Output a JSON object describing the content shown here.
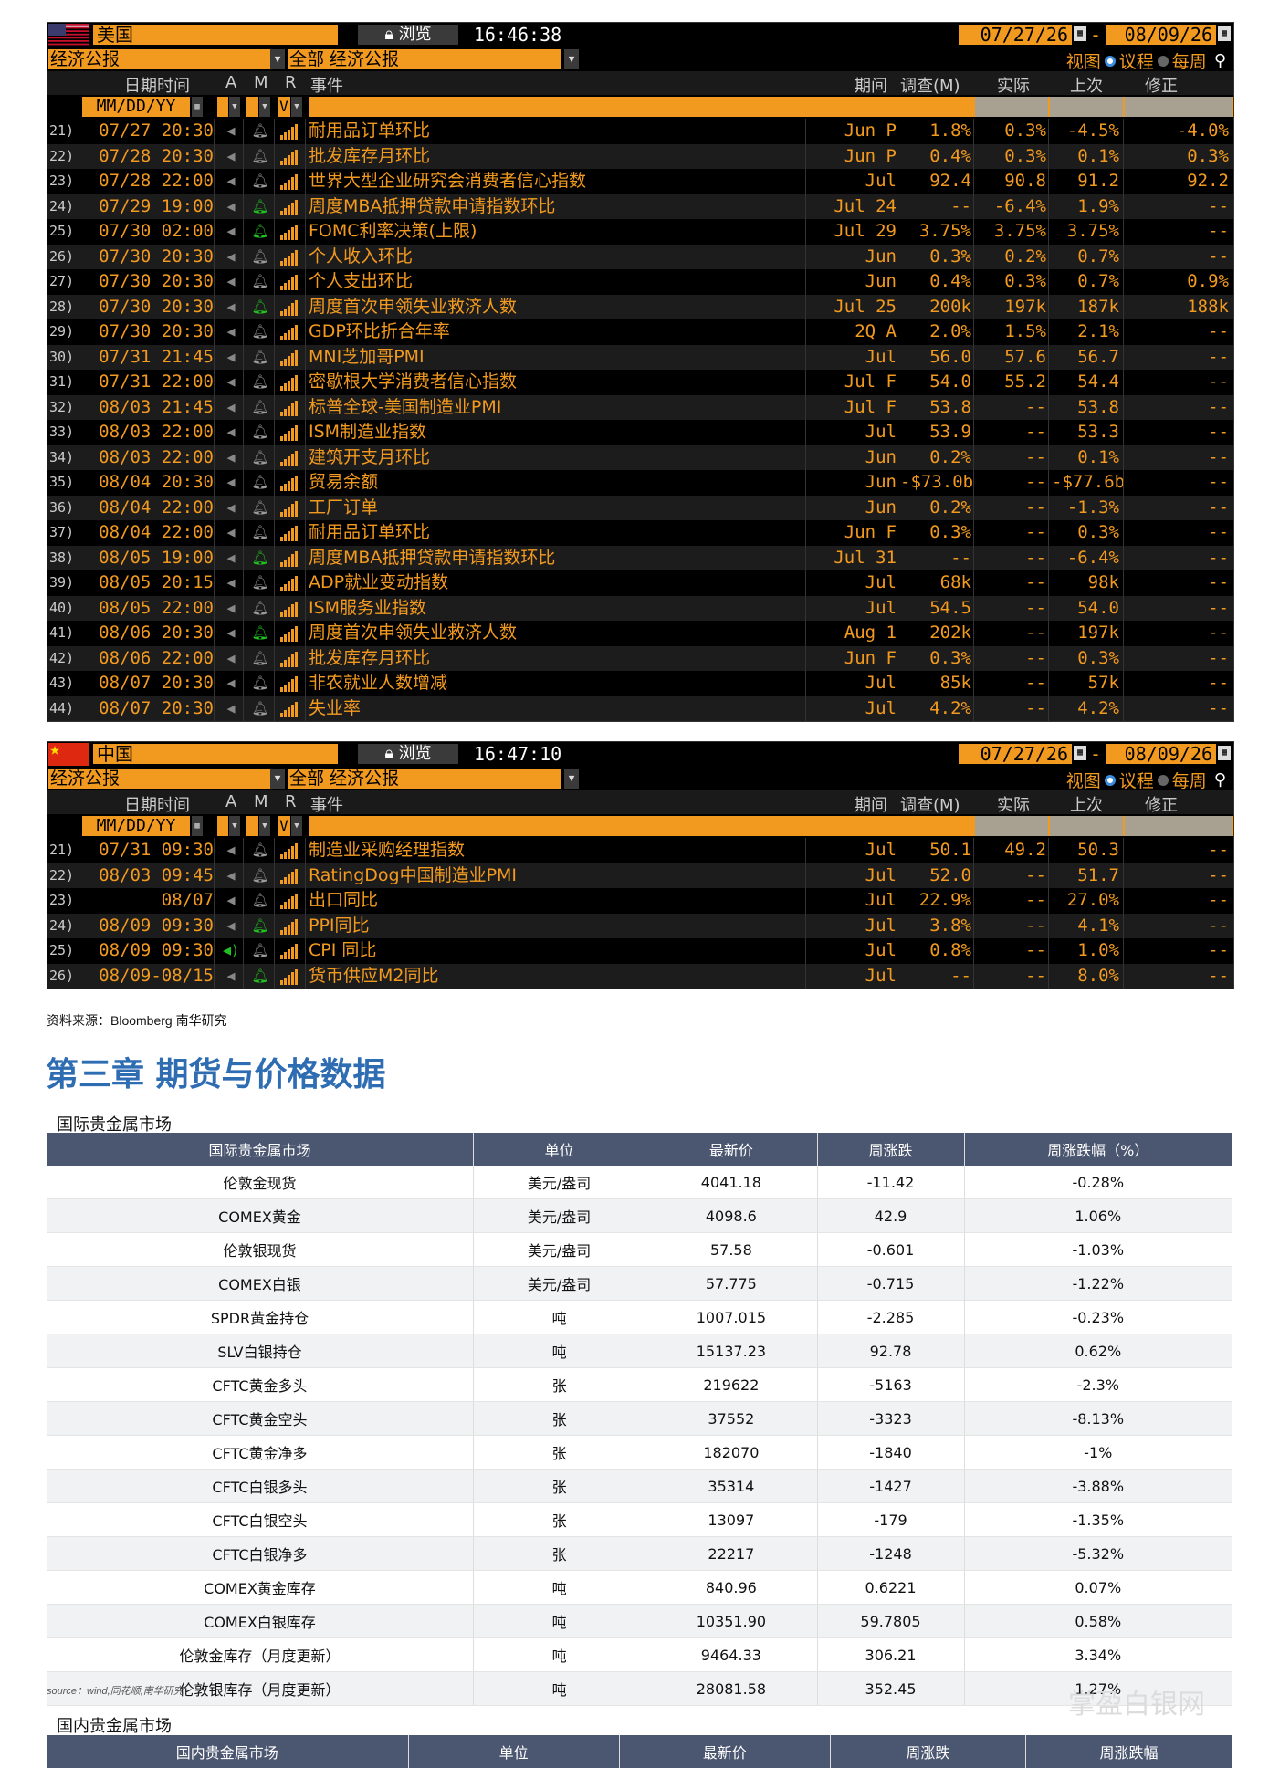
{
  "colors": {
    "bb_orange": "#f29a1f",
    "bb_green_bell": "#21c021",
    "table_header": "#4b5670",
    "chapter_blue": "#2f6db3"
  },
  "panels": [
    {
      "country": "美国",
      "browse": "浏览",
      "time": "16:46:38",
      "date_from": "07/27/26",
      "date_to": "08/09/26",
      "filter1": "经济公报",
      "filter2": "全部 经济公报",
      "view_label": "视图",
      "agenda_label": "议程",
      "weekly_label": "每周",
      "headers": {
        "datetime": "日期时间",
        "a": "A",
        "m": "M",
        "r": "R",
        "event": "事件",
        "period": "期间",
        "survey": "调查(M)",
        "actual": "实际",
        "prior": "上次",
        "revised": "修正"
      },
      "date_format": "MM/DD/YY",
      "v_label": "V",
      "rows": [
        {
          "n": "21)",
          "dt": "07/27 20:30",
          "bell": false,
          "ev": "耐用品订单环比",
          "per": "Jun P",
          "sur": "1.8%",
          "act": "0.3%",
          "prv": "-4.5%",
          "rev": "-4.0%"
        },
        {
          "n": "22)",
          "dt": "07/28 20:30",
          "bell": false,
          "ev": "批发库存月环比",
          "per": "Jun P",
          "sur": "0.4%",
          "act": "0.3%",
          "prv": "0.1%",
          "rev": "0.3%"
        },
        {
          "n": "23)",
          "dt": "07/28 22:00",
          "bell": false,
          "ev": "世界大型企业研究会消费者信心指数",
          "per": "Jul",
          "sur": "92.4",
          "act": "90.8",
          "prv": "91.2",
          "rev": "92.2"
        },
        {
          "n": "24)",
          "dt": "07/29 19:00",
          "bell": true,
          "ev": "周度MBA抵押贷款申请指数环比",
          "per": "Jul 24",
          "sur": "--",
          "act": "-6.4%",
          "prv": "1.9%",
          "rev": "--"
        },
        {
          "n": "25)",
          "dt": "07/30 02:00",
          "bell": true,
          "ev": "FOMC利率决策(上限)",
          "per": "Jul 29",
          "sur": "3.75%",
          "act": "3.75%",
          "prv": "3.75%",
          "rev": "--"
        },
        {
          "n": "26)",
          "dt": "07/30 20:30",
          "bell": false,
          "ev": "个人收入环比",
          "per": "Jun",
          "sur": "0.3%",
          "act": "0.2%",
          "prv": "0.7%",
          "rev": "--"
        },
        {
          "n": "27)",
          "dt": "07/30 20:30",
          "bell": false,
          "ev": "个人支出环比",
          "per": "Jun",
          "sur": "0.4%",
          "act": "0.3%",
          "prv": "0.7%",
          "rev": "0.9%"
        },
        {
          "n": "28)",
          "dt": "07/30 20:30",
          "bell": true,
          "ev": "周度首次申领失业救济人数",
          "per": "Jul 25",
          "sur": "200k",
          "act": "197k",
          "prv": "187k",
          "rev": "188k"
        },
        {
          "n": "29)",
          "dt": "07/30 20:30",
          "bell": false,
          "ev": "GDP环比折合年率",
          "per": "2Q A",
          "sur": "2.0%",
          "act": "1.5%",
          "prv": "2.1%",
          "rev": "--"
        },
        {
          "n": "30)",
          "dt": "07/31 21:45",
          "bell": false,
          "ev": "MNI芝加哥PMI",
          "per": "Jul",
          "sur": "56.0",
          "act": "57.6",
          "prv": "56.7",
          "rev": "--"
        },
        {
          "n": "31)",
          "dt": "07/31 22:00",
          "bell": false,
          "ev": "密歇根大学消费者信心指数",
          "per": "Jul F",
          "sur": "54.0",
          "act": "55.2",
          "prv": "54.4",
          "rev": "--"
        },
        {
          "n": "32)",
          "dt": "08/03 21:45",
          "bell": false,
          "ev": "标普全球-美国制造业PMI",
          "per": "Jul F",
          "sur": "53.8",
          "act": "--",
          "prv": "53.8",
          "rev": "--"
        },
        {
          "n": "33)",
          "dt": "08/03 22:00",
          "bell": false,
          "ev": "ISM制造业指数",
          "per": "Jul",
          "sur": "53.9",
          "act": "--",
          "prv": "53.3",
          "rev": "--"
        },
        {
          "n": "34)",
          "dt": "08/03 22:00",
          "bell": false,
          "ev": "建筑开支月环比",
          "per": "Jun",
          "sur": "0.2%",
          "act": "--",
          "prv": "0.1%",
          "rev": "--"
        },
        {
          "n": "35)",
          "dt": "08/04 20:30",
          "bell": false,
          "ev": "贸易余额",
          "per": "Jun",
          "sur": "-$73.0b",
          "act": "--",
          "prv": "-$77.6b",
          "rev": "--"
        },
        {
          "n": "36)",
          "dt": "08/04 22:00",
          "bell": false,
          "ev": "工厂订单",
          "per": "Jun",
          "sur": "0.2%",
          "act": "--",
          "prv": "-1.3%",
          "rev": "--"
        },
        {
          "n": "37)",
          "dt": "08/04 22:00",
          "bell": false,
          "ev": "耐用品订单环比",
          "per": "Jun F",
          "sur": "0.3%",
          "act": "--",
          "prv": "0.3%",
          "rev": "--"
        },
        {
          "n": "38)",
          "dt": "08/05 19:00",
          "bell": true,
          "ev": "周度MBA抵押贷款申请指数环比",
          "per": "Jul 31",
          "sur": "--",
          "act": "--",
          "prv": "-6.4%",
          "rev": "--"
        },
        {
          "n": "39)",
          "dt": "08/05 20:15",
          "bell": false,
          "ev": "ADP就业变动指数",
          "per": "Jul",
          "sur": "68k",
          "act": "--",
          "prv": "98k",
          "rev": "--"
        },
        {
          "n": "40)",
          "dt": "08/05 22:00",
          "bell": false,
          "ev": "ISM服务业指数",
          "per": "Jul",
          "sur": "54.5",
          "act": "--",
          "prv": "54.0",
          "rev": "--"
        },
        {
          "n": "41)",
          "dt": "08/06 20:30",
          "bell": true,
          "ev": "周度首次申领失业救济人数",
          "per": "Aug 1",
          "sur": "202k",
          "act": "--",
          "prv": "197k",
          "rev": "--"
        },
        {
          "n": "42)",
          "dt": "08/06 22:00",
          "bell": false,
          "ev": "批发库存月环比",
          "per": "Jun F",
          "sur": "0.3%",
          "act": "--",
          "prv": "0.3%",
          "rev": "--"
        },
        {
          "n": "43)",
          "dt": "08/07 20:30",
          "bell": false,
          "ev": "非农就业人数增减",
          "per": "Jul",
          "sur": "85k",
          "act": "--",
          "prv": "57k",
          "rev": "--"
        },
        {
          "n": "44)",
          "dt": "08/07 20:30",
          "bell": false,
          "ev": "失业率",
          "per": "Jul",
          "sur": "4.2%",
          "act": "--",
          "prv": "4.2%",
          "rev": "--"
        }
      ]
    },
    {
      "country": "中国",
      "browse": "浏览",
      "time": "16:47:10",
      "date_from": "07/27/26",
      "date_to": "08/09/26",
      "filter1": "经济公报",
      "filter2": "全部 经济公报",
      "view_label": "视图",
      "agenda_label": "议程",
      "weekly_label": "每周",
      "headers": {
        "datetime": "日期时间",
        "a": "A",
        "m": "M",
        "r": "R",
        "event": "事件",
        "period": "期间",
        "survey": "调查(M)",
        "actual": "实际",
        "prior": "上次",
        "revised": "修正"
      },
      "date_format": "MM/DD/YY",
      "v_label": "V",
      "rows": [
        {
          "n": "21)",
          "dt": "07/31 09:30",
          "bell": false,
          "ev": "制造业采购经理指数",
          "per": "Jul",
          "sur": "50.1",
          "act": "49.2",
          "prv": "50.3",
          "rev": "--"
        },
        {
          "n": "22)",
          "dt": "08/03 09:45",
          "bell": false,
          "ev": "RatingDog中国制造业PMI",
          "per": "Jul",
          "sur": "52.0",
          "act": "--",
          "prv": "51.7",
          "rev": "--"
        },
        {
          "n": "23)",
          "dt": "08/07",
          "bell": false,
          "ev": "出口同比",
          "per": "Jul",
          "sur": "22.9%",
          "act": "--",
          "prv": "27.0%",
          "rev": "--"
        },
        {
          "n": "24)",
          "dt": "08/09 09:30",
          "bell": true,
          "ev": "PPI同比",
          "per": "Jul",
          "sur": "3.8%",
          "act": "--",
          "prv": "4.1%",
          "rev": "--"
        },
        {
          "n": "25)",
          "dt": "08/09 09:30",
          "bell": false,
          "spk_on": true,
          "ev": "CPI 同比",
          "per": "Jul",
          "sur": "0.8%",
          "act": "--",
          "prv": "1.0%",
          "rev": "--"
        },
        {
          "n": "26)",
          "dt": "08/09-08/15",
          "bell": true,
          "ev": "货币供应M2同比",
          "per": "Jul",
          "sur": "--",
          "act": "--",
          "prv": "8.0%",
          "rev": "--"
        }
      ]
    }
  ],
  "source1": "资料来源：Bloomberg 南华研究",
  "chapter_title": "第三章 期货与价格数据",
  "intl_section": "国际贵金属市场",
  "intl_table": {
    "headers": [
      "国际贵金属市场",
      "单位",
      "最新价",
      "周涨跌",
      "周涨跌幅（%）"
    ],
    "rows": [
      [
        "伦敦金现货",
        "美元/盎司",
        "4041.18",
        "-11.42",
        "-0.28%"
      ],
      [
        "COMEX黄金",
        "美元/盎司",
        "4098.6",
        "42.9",
        "1.06%"
      ],
      [
        "伦敦银现货",
        "美元/盎司",
        "57.58",
        "-0.601",
        "-1.03%"
      ],
      [
        "COMEX白银",
        "美元/盎司",
        "57.775",
        "-0.715",
        "-1.22%"
      ],
      [
        "SPDR黄金持仓",
        "吨",
        "1007.015",
        "-2.285",
        "-0.23%"
      ],
      [
        "SLV白银持仓",
        "吨",
        "15137.23",
        "92.78",
        "0.62%"
      ],
      [
        "CFTC黄金多头",
        "张",
        "219622",
        "-5163",
        "-2.3%"
      ],
      [
        "CFTC黄金空头",
        "张",
        "37552",
        "-3323",
        "-8.13%"
      ],
      [
        "CFTC黄金净多",
        "张",
        "182070",
        "-1840",
        "-1%"
      ],
      [
        "CFTC白银多头",
        "张",
        "35314",
        "-1427",
        "-3.88%"
      ],
      [
        "CFTC白银空头",
        "张",
        "13097",
        "-179",
        "-1.35%"
      ],
      [
        "CFTC白银净多",
        "张",
        "22217",
        "-1248",
        "-5.32%"
      ],
      [
        "COMEX黄金库存",
        "吨",
        "840.96",
        "0.6221",
        "0.07%"
      ],
      [
        "COMEX白银库存",
        "吨",
        "10351.90",
        "59.7805",
        "0.58%"
      ],
      [
        "伦敦金库存（月度更新）",
        "吨",
        "9464.33",
        "306.21",
        "3.34%"
      ],
      [
        "伦敦银库存（月度更新）",
        "吨",
        "28081.58",
        "352.45",
        "1.27%"
      ]
    ]
  },
  "source2": "source：wind,同花顺,南华研究",
  "domestic_section": "国内贵金属市场",
  "domestic_headers": [
    "国内贵金属市场",
    "单位",
    "最新价",
    "周涨跌",
    "周涨跌幅"
  ],
  "watermark": "掌盈白银网"
}
